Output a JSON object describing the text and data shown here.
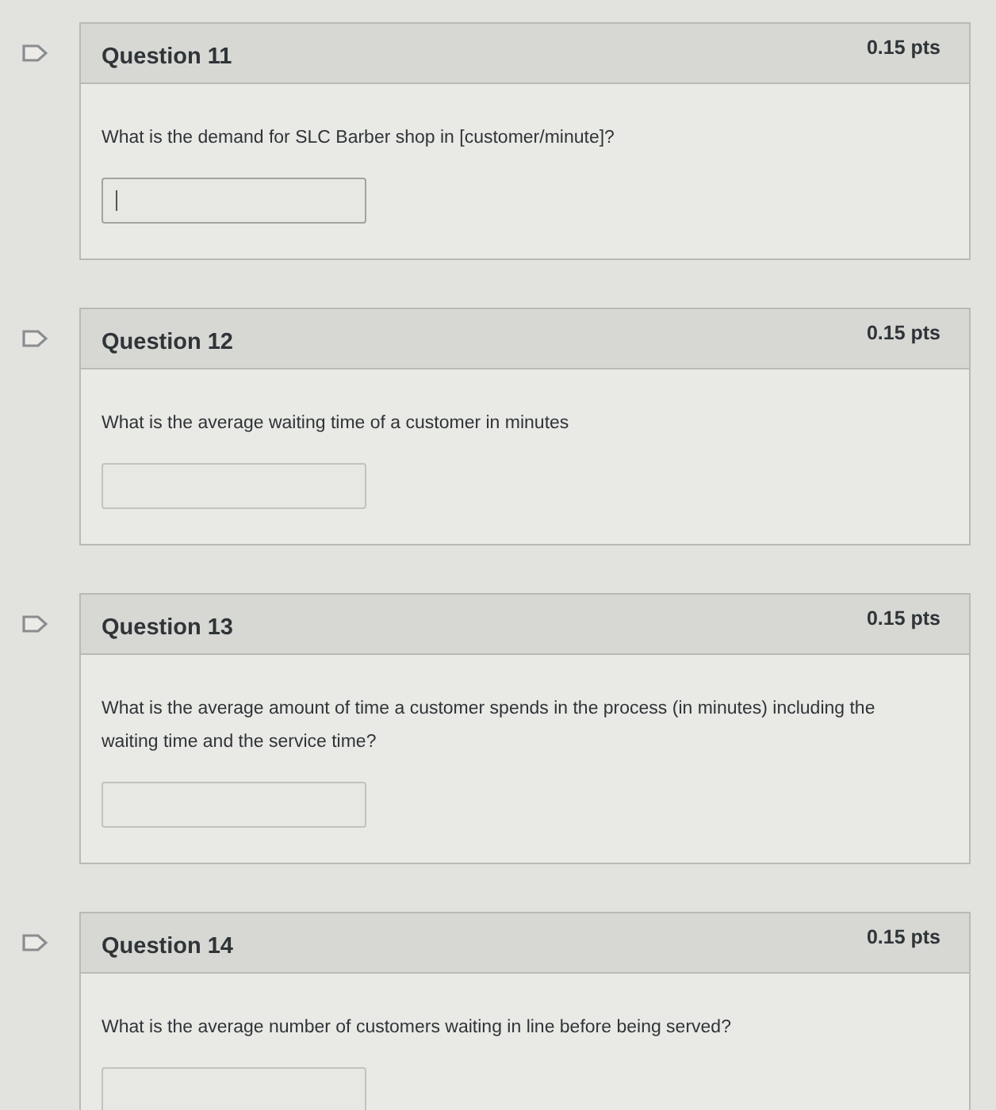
{
  "questions": [
    {
      "title": "Question 11",
      "points": "0.15 pts",
      "flagged": false,
      "text": "What is the demand for SLC Barber shop in [customer/minute]?",
      "answer_field": {
        "focused": true
      }
    },
    {
      "title": "Question 12",
      "points": "0.15 pts",
      "flagged": false,
      "text": "What is the average waiting time of a customer in minutes",
      "answer_field": {
        "focused": false
      }
    },
    {
      "title": "Question 13",
      "points": "0.15 pts",
      "flagged": false,
      "text": "What is the average amount of time a customer spends in the process (in minutes) including the waiting time and the service time?",
      "answer_field": {
        "focused": false
      }
    },
    {
      "title": "Question 14",
      "points": "0.15 pts",
      "flagged": false,
      "text": "What is the average number of customers waiting in line before being served?",
      "answer_field": {
        "focused": false
      }
    }
  ]
}
